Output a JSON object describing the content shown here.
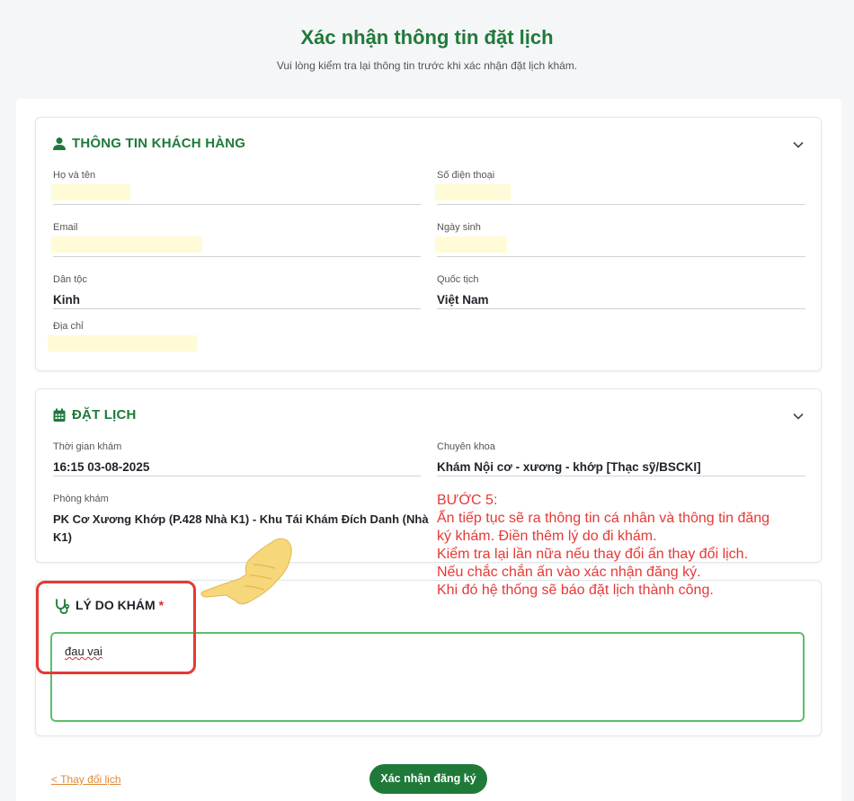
{
  "header": {
    "title": "Xác nhận thông tin đặt lịch",
    "subtitle": "Vui lòng kiểm tra lại thông tin trước khi xác nhận đặt lịch khám."
  },
  "customer": {
    "title": "THÔNG TIN KHÁCH HÀNG",
    "icon": "person-icon",
    "fields": {
      "name_label": "Họ và tên",
      "phone_label": "Số điện thoại",
      "email_label": "Email",
      "dob_label": "Ngày sinh",
      "ethnicity_label": "Dân tộc",
      "ethnicity_value": "Kinh",
      "nationality_label": "Quốc tịch",
      "nationality_value": "Việt Nam",
      "address_label": "Địa chỉ"
    }
  },
  "booking": {
    "title": "ĐẶT LỊCH",
    "icon": "calendar-icon",
    "fields": {
      "time_label": "Thời gian khám",
      "time_value": "16:15 03-08-2025",
      "specialty_label": "Chuyên khoa",
      "specialty_value": "Khám Nội cơ - xương - khớp [Thạc sỹ/BSCKI]",
      "clinic_label": "Phòng khám",
      "clinic_value_line1": "PK Cơ Xương Khớp (P.428 Nhà K1) - Khu Tái Khám Đích Danh (Nhà",
      "clinic_value_line2": "K1)"
    }
  },
  "reason": {
    "title": "LÝ DO KHÁM",
    "required_mark": "*",
    "icon": "stethoscope-icon",
    "value": "đau vai"
  },
  "annotation": {
    "lines": [
      "BƯỚC 5:",
      "Ấn tiếp tục sẽ ra thông tin cá nhân và thông tin đăng",
      "ký khám. Điền thêm lý do đi khám.",
      "Kiểm tra lại lần nữa nếu thay đổi ấn thay đổi lịch.",
      "Nếu chắc chắn ấn vào xác nhận đăng ký.",
      "Khi đó hệ thống sẽ báo đặt lịch thành công."
    ]
  },
  "footer": {
    "back_label": "< Thay đổi lịch",
    "confirm_label": "Xác nhận đăng ký"
  },
  "colors": {
    "brand": "#1f7a3a",
    "annotation": "#e53935",
    "link": "#e08a3c"
  }
}
